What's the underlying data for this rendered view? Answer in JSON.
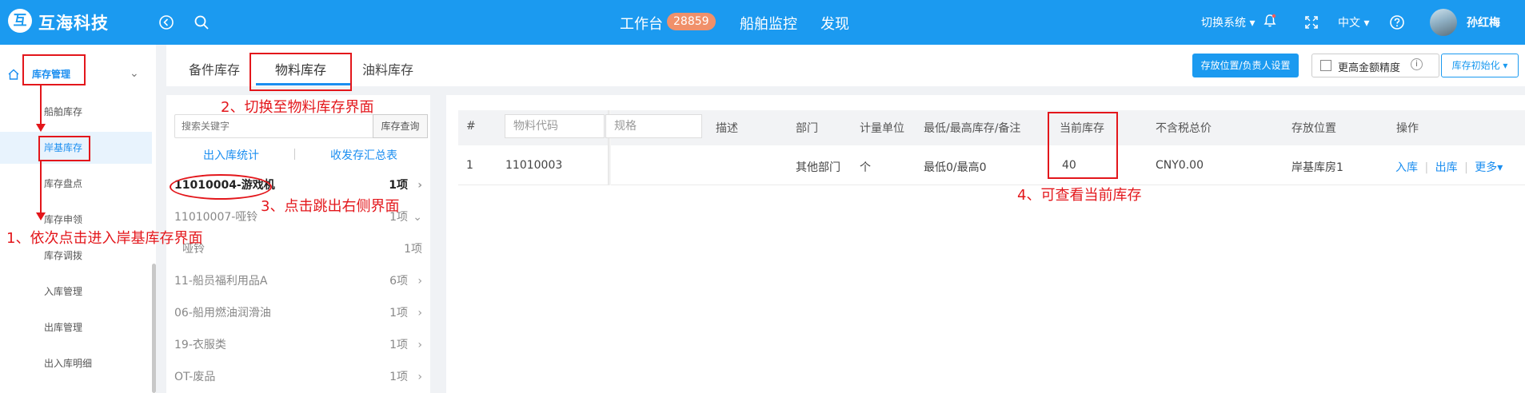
{
  "header": {
    "logo_mark": "互",
    "brand": "互海科技",
    "nav": [
      {
        "label": "工作台"
      },
      {
        "label": "船舶监控"
      },
      {
        "label": "发现"
      }
    ],
    "workbench_badge": "28859",
    "switch_system": "切换系统",
    "language": "中文",
    "user_name": "孙红梅"
  },
  "sidebar": {
    "section_label": "库存管理",
    "items": [
      {
        "label": "船舶库存"
      },
      {
        "label": "岸基库存"
      },
      {
        "label": "库存盘点"
      },
      {
        "label": "库存申领"
      },
      {
        "label": "库存调拨"
      },
      {
        "label": "入库管理"
      },
      {
        "label": "出库管理"
      },
      {
        "label": "出入库明细"
      }
    ]
  },
  "tabs": [
    {
      "label": "备件库存"
    },
    {
      "label": "物料库存"
    },
    {
      "label": "油料库存"
    }
  ],
  "toolbar": {
    "storage_setting": "存放位置/负责人设置",
    "precision_label": "更高金额精度",
    "init_label": "库存初始化"
  },
  "left_panel": {
    "search_placeholder": "搜索关键字",
    "search_button": "库存查询",
    "link_inout_stats": "出入库统计",
    "link_summary": "收发存汇总表",
    "categories": [
      {
        "name": "11010004-游戏机",
        "count": "1项"
      },
      {
        "name": "11010007-哑铃",
        "count": "1项"
      },
      {
        "name": "哑铃",
        "count": "1项"
      },
      {
        "name": "11-船员福利用品A",
        "count": "6项"
      },
      {
        "name": "06-船用燃油润滑油",
        "count": "1项"
      },
      {
        "name": "19-衣服类",
        "count": "1项"
      },
      {
        "name": "OT-废品",
        "count": "1项"
      }
    ]
  },
  "table": {
    "headers": {
      "index": "#",
      "code": "物料代码",
      "spec": "规格",
      "desc": "描述",
      "dept": "部门",
      "unit": "计量单位",
      "minmax": "最低/最高库存/备注",
      "current": "当前库存",
      "total": "不含税总价",
      "location": "存放位置",
      "ops": "操作"
    },
    "rows": [
      {
        "index": "1",
        "code": "11010003",
        "spec": "",
        "desc": "",
        "dept": "其他部门",
        "unit": "个",
        "minmax": "最低0/最高0",
        "current": "40",
        "total": "CNY0.00",
        "location": "岸基库房1",
        "op_in": "入库",
        "op_out": "出库",
        "op_more": "更多"
      }
    ]
  },
  "annotations": {
    "step1": "1、依次点击进入岸基库存界面",
    "step2": "2、切换至物料库存界面",
    "step3": "3、点击跳出右侧界面",
    "step4": "4、可查看当前库存"
  },
  "colors": {
    "header_bg": "#1b9af0",
    "accent": "#1b8ef0",
    "annotation": "#e3161b",
    "badge": "#f0906a"
  }
}
